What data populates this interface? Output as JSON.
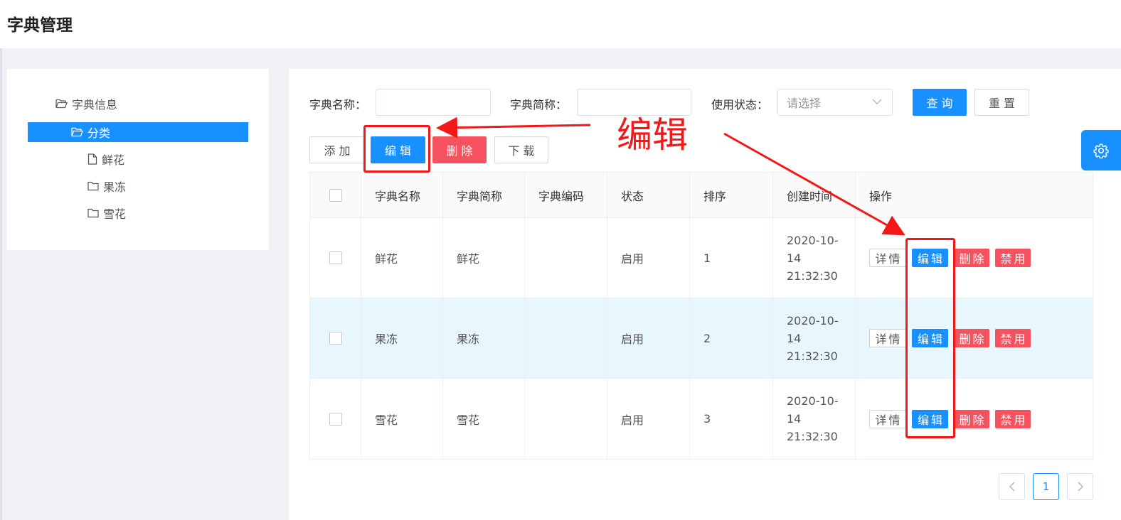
{
  "page": {
    "title": "字典管理"
  },
  "tree": {
    "root": "字典信息",
    "selected": "分类",
    "children": [
      "鲜花",
      "果冻",
      "雪花"
    ]
  },
  "search": {
    "name_label": "字典名称：",
    "name_value": "",
    "short_label": "字典简称：",
    "short_value": "",
    "status_label": "使用状态：",
    "status_placeholder": "请选择",
    "query_label": "查询",
    "reset_label": "重置"
  },
  "toolbar": {
    "add_label": "添加",
    "edit_label": "编辑",
    "delete_label": "删除",
    "download_label": "下载"
  },
  "table": {
    "columns": [
      "字典名称",
      "字典简称",
      "字典编码",
      "状态",
      "排序",
      "创建时间",
      "操作"
    ],
    "rows": [
      {
        "name": "鲜花",
        "short": "鲜花",
        "code": "",
        "status": "启用",
        "order": "1",
        "created": "2020-10-\n14\n21:32:30"
      },
      {
        "name": "果冻",
        "short": "果冻",
        "code": "",
        "status": "启用",
        "order": "2",
        "created": "2020-10-\n14\n21:32:30"
      },
      {
        "name": "雪花",
        "short": "雪花",
        "code": "",
        "status": "启用",
        "order": "3",
        "created": "2020-10-\n14\n21:32:30"
      }
    ],
    "row_actions": {
      "detail": "详情",
      "edit": "编辑",
      "delete": "删除",
      "disable": "禁用"
    }
  },
  "pagination": {
    "current_page": "1",
    "prev_icon": "chevron-left-icon",
    "next_icon": "chevron-right-icon"
  },
  "annotation": {
    "label": "编辑",
    "color": "#f21818"
  },
  "colors": {
    "primary": "#1890ff",
    "danger": "#f5515f",
    "highlight_row": "#e8f6fd"
  }
}
